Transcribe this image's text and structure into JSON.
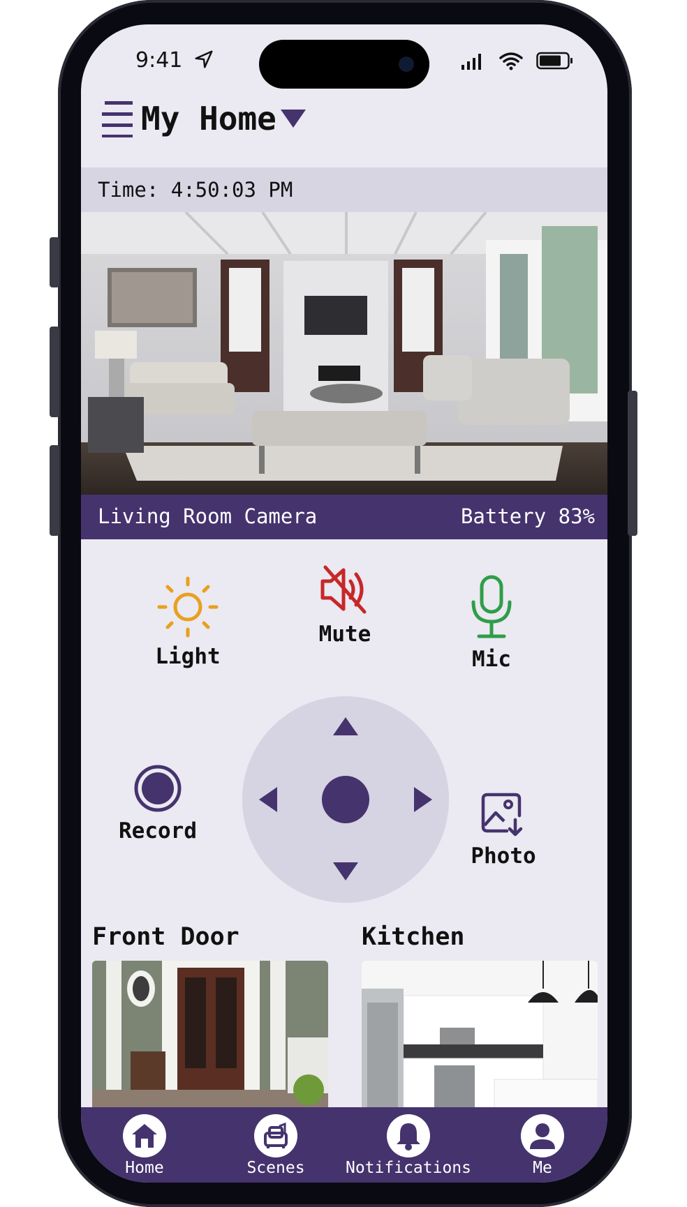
{
  "status_bar": {
    "time": "9:41"
  },
  "header": {
    "title": "My Home"
  },
  "time_bar": {
    "text": "Time: 4:50:03 PM"
  },
  "camera": {
    "name": "Living Room Camera",
    "battery": "Battery 83%"
  },
  "controls": {
    "light": "Light",
    "mute": "Mute",
    "mic": "Mic",
    "record": "Record",
    "photo": "Photo"
  },
  "rooms": [
    {
      "name": "Front Door"
    },
    {
      "name": "Kitchen"
    }
  ],
  "tabs": [
    {
      "label": "Home",
      "icon": "home-icon"
    },
    {
      "label": "Scenes",
      "icon": "scenes-icon"
    },
    {
      "label": "Notifications",
      "icon": "bell-icon"
    },
    {
      "label": "Me",
      "icon": "user-icon"
    }
  ],
  "colors": {
    "accent": "#45336e",
    "light_icon": "#e8a020",
    "mute_icon": "#c62828",
    "mic_icon": "#2e9e48",
    "background": "#ebe9f1"
  }
}
